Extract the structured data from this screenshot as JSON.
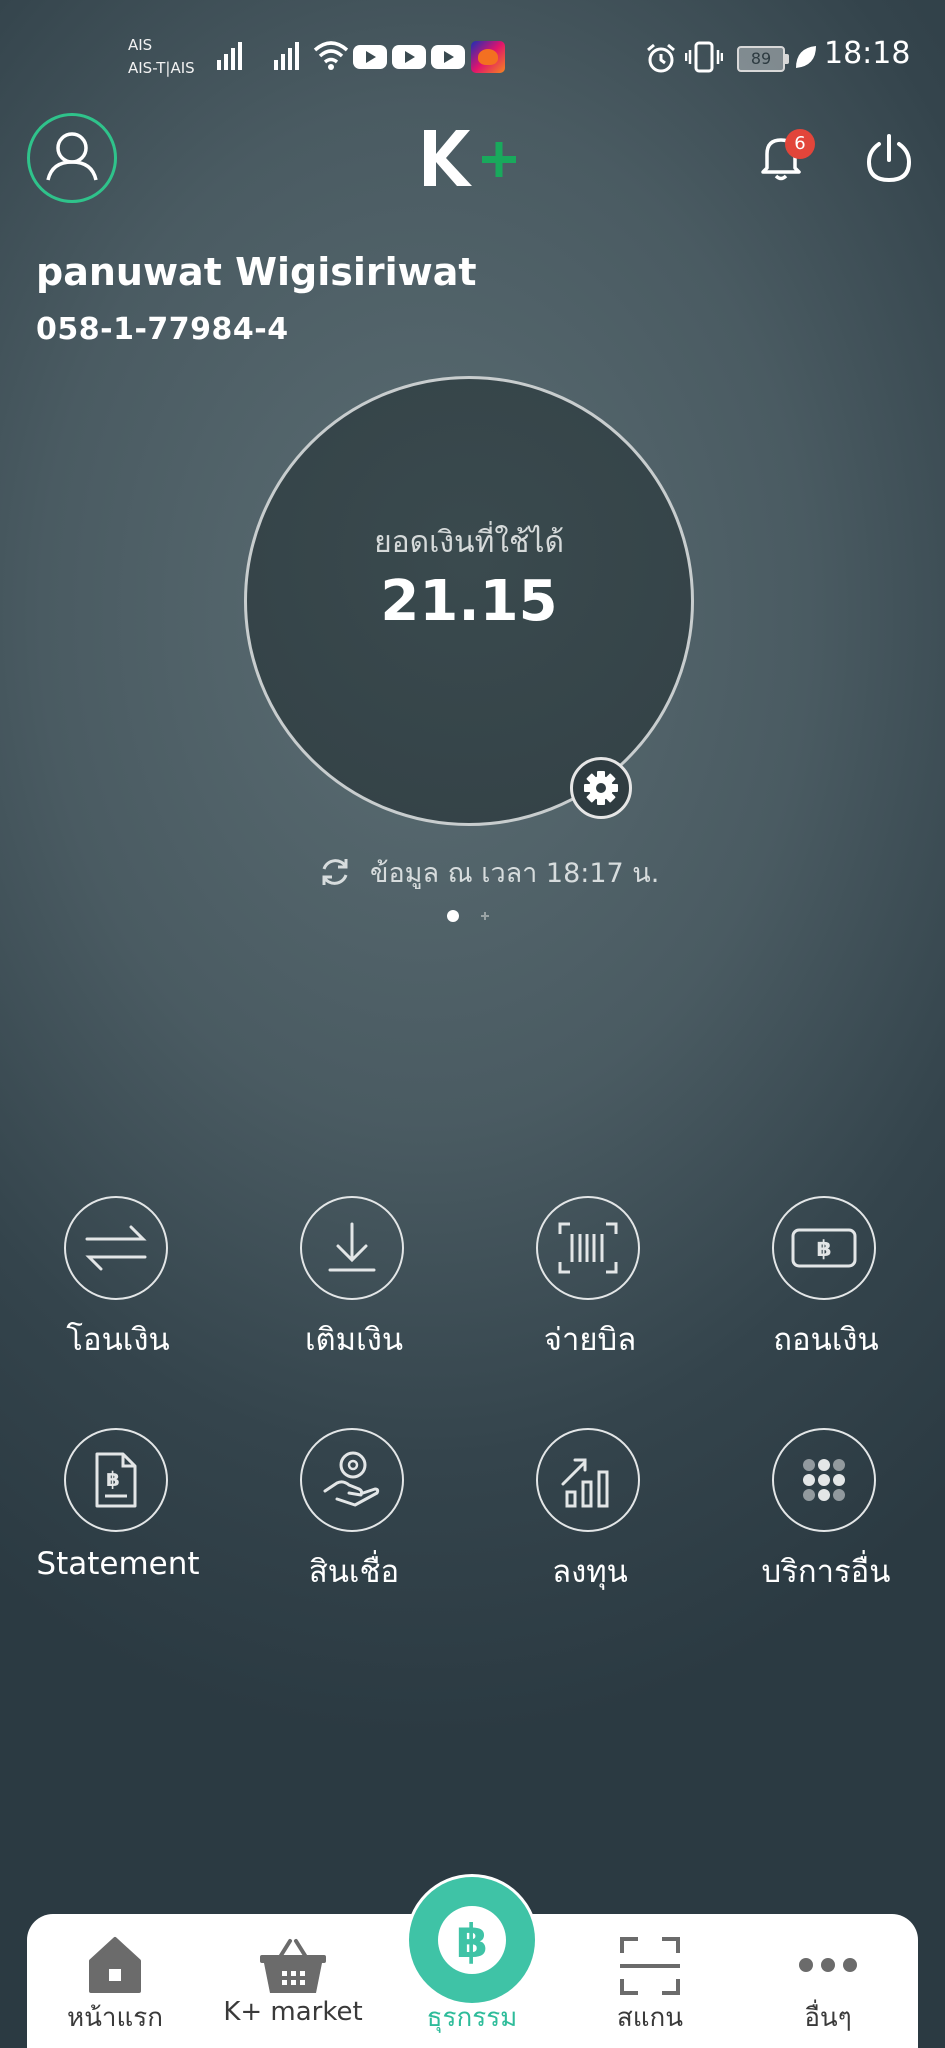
{
  "status_bar": {
    "carrier_line1": "AIS",
    "carrier_line2": "AIS-T|AIS",
    "battery": "89",
    "time": "18:18"
  },
  "header": {
    "notification_count": "6"
  },
  "account": {
    "name": "panuwat Wigisiriwat",
    "number": "058-1-77984-4"
  },
  "balance": {
    "label": "ยอดเงินที่ใช้ได้",
    "value": "21.15",
    "updated_text": "ข้อมูล ณ เวลา 18:17 น."
  },
  "menu": [
    {
      "label": "โอนเงิน",
      "icon": "transfer-icon"
    },
    {
      "label": "เติมเงิน",
      "icon": "topup-icon"
    },
    {
      "label": "จ่ายบิล",
      "icon": "barcode-icon"
    },
    {
      "label": "ถอนเงิน",
      "icon": "withdraw-icon"
    },
    {
      "label": "Statement",
      "icon": "statement-icon"
    },
    {
      "label": "สินเชื่อ",
      "icon": "loan-icon"
    },
    {
      "label": "ลงทุน",
      "icon": "invest-chart-icon"
    },
    {
      "label": "บริการอื่น",
      "icon": "grid-dots-icon"
    }
  ],
  "bottom_nav": [
    {
      "label": "หน้าแรก",
      "icon": "home-icon"
    },
    {
      "label": "K+ market",
      "icon": "basket-icon"
    },
    {
      "label": "ธุรกรรม",
      "icon": "baht-icon"
    },
    {
      "label": "สแกน",
      "icon": "scan-icon"
    },
    {
      "label": "อื่นๆ",
      "icon": "more-icon"
    }
  ],
  "colors": {
    "accent_green": "#2fc38b",
    "nav_active": "#3fc3a6",
    "badge_red": "#e2453a"
  }
}
